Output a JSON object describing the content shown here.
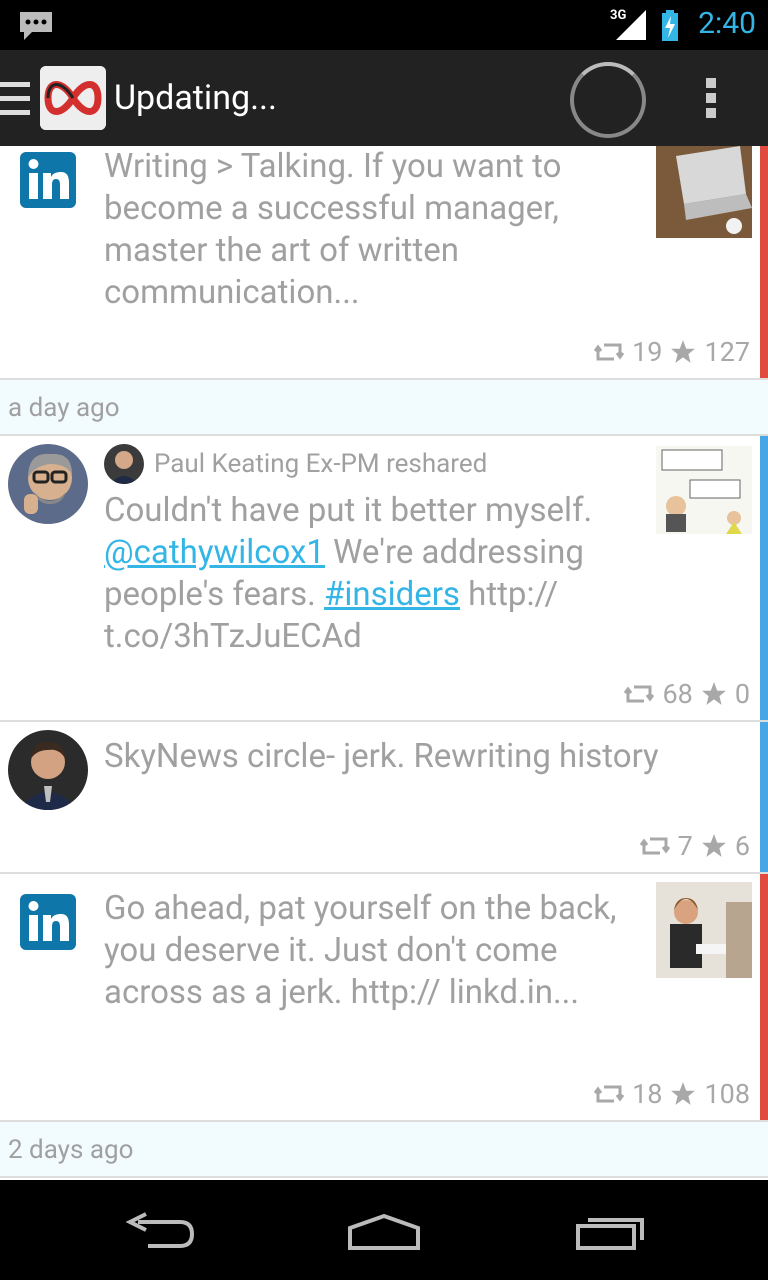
{
  "status_bar": {
    "time": "2:40",
    "network": "3G"
  },
  "action_bar": {
    "title": "Updating..."
  },
  "colors": {
    "accent": "#33b5e5",
    "linkedin_edge": "#e04a3f",
    "twitter_edge": "#46a6e6"
  },
  "feed": {
    "item1": {
      "text": "Writing > Talking. If you want to become a successful manager, master the art of written communication...",
      "retweets": "19",
      "stars": "127"
    },
    "divider1": "a day ago",
    "item2": {
      "reshared_by": "Paul Keating Ex-PM reshared",
      "text_start": "Couldn't have put it better myself. ",
      "mention": "@cathywilcox1",
      "text_middle": " We're addressing people's fears. ",
      "hashtag": "#insiders",
      "text_end": " http:// t.co/3hTzJuECAd",
      "retweets": "68",
      "stars": "0"
    },
    "item3": {
      "text": "SkyNews circle- jerk. Rewriting history",
      "retweets": "7",
      "stars": "6"
    },
    "item4": {
      "text": "Go ahead, pat yourself on the back, you deserve it. Just don't come across as a jerk. http:// linkd.in...",
      "retweets": "18",
      "stars": "108"
    },
    "divider2": "2 days ago"
  }
}
